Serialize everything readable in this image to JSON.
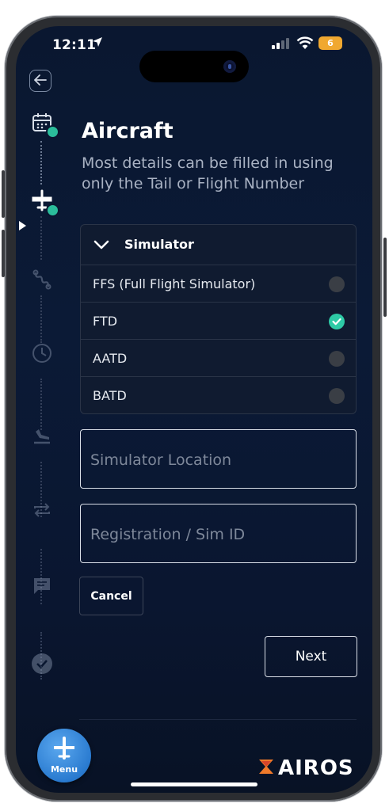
{
  "status_bar": {
    "time": "12:11",
    "battery": "6"
  },
  "header": {
    "title": "Aircraft",
    "subtitle": "Most details can be filled in using only the Tail or Flight Number"
  },
  "simulator": {
    "label": "Simulator",
    "options": [
      {
        "label": "FFS (Full Flight Simulator)",
        "selected": false
      },
      {
        "label": "FTD",
        "selected": true
      },
      {
        "label": "AATD",
        "selected": false
      },
      {
        "label": "BATD",
        "selected": false
      }
    ]
  },
  "fields": {
    "location_placeholder": "Simulator Location",
    "registration_placeholder": "Registration / Sim ID"
  },
  "buttons": {
    "cancel": "Cancel",
    "next": "Next"
  },
  "footer": {
    "menu_label": "Menu",
    "brand": "AIROS"
  },
  "colors": {
    "background": "#0b1a36",
    "accent_check": "#2ecaa6",
    "menu_button": "#2a7bd0",
    "brand_mark": "#f07a2a"
  },
  "rail_icons": [
    "calendar-icon",
    "airplane-icon",
    "route-icon",
    "clock-icon",
    "landing-icon",
    "repeat-icon",
    "comment-icon",
    "check-circle-icon"
  ]
}
